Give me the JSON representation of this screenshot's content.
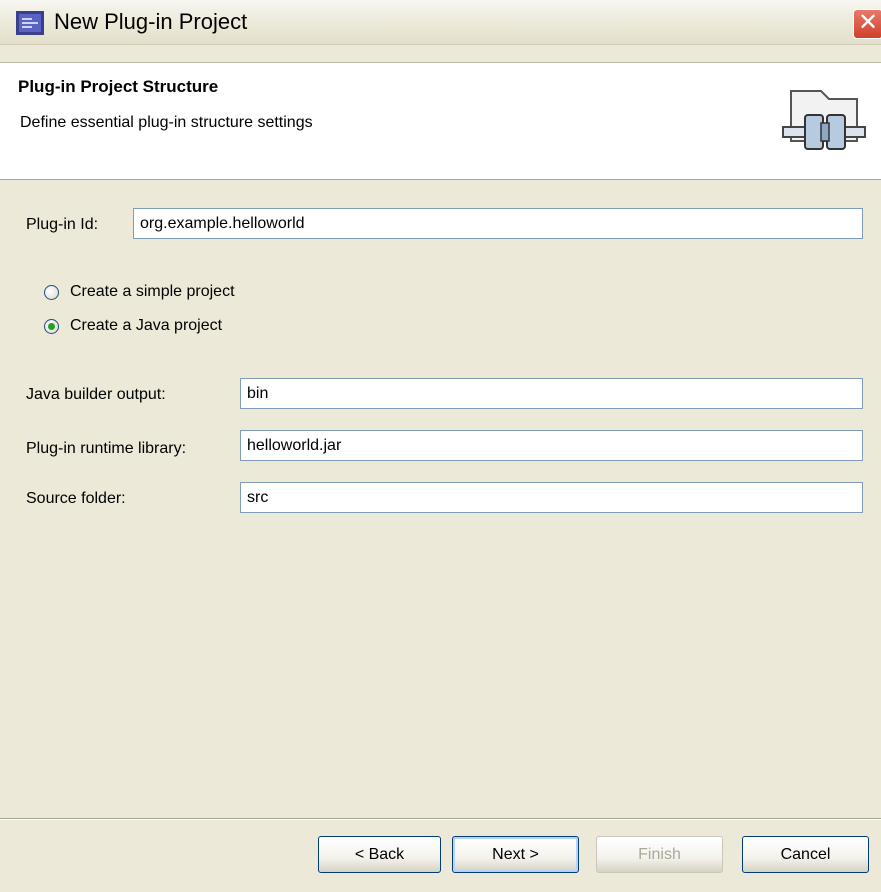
{
  "window": {
    "title": "New Plug-in Project",
    "app_icon": "eclipse-icon",
    "close_icon": "close-icon",
    "close_glyph": "✕"
  },
  "banner": {
    "title": "Plug-in Project Structure",
    "description": "Define essential plug-in structure settings",
    "icon": "plugin-connector-icon"
  },
  "form": {
    "plugin_id": {
      "label": "Plug-in Id:",
      "value": "org.example.helloworld"
    },
    "project_type": {
      "options": [
        {
          "label": "Create a simple project",
          "selected": false
        },
        {
          "label": "Create a Java project",
          "selected": true
        }
      ]
    },
    "java_builder_output": {
      "label": "Java builder output:",
      "value": "bin"
    },
    "runtime_library": {
      "label": "Plug-in runtime library:",
      "value": "helloworld.jar"
    },
    "source_folder": {
      "label": "Source folder:",
      "value": "src"
    }
  },
  "buttons": {
    "back": "< Back",
    "next": "Next >",
    "finish": "Finish",
    "cancel": "Cancel"
  },
  "colors": {
    "dialog_background": "#ece9d8",
    "banner_background": "#ffffff",
    "field_border": "#7f9db9",
    "close_button": "#d0402a"
  }
}
